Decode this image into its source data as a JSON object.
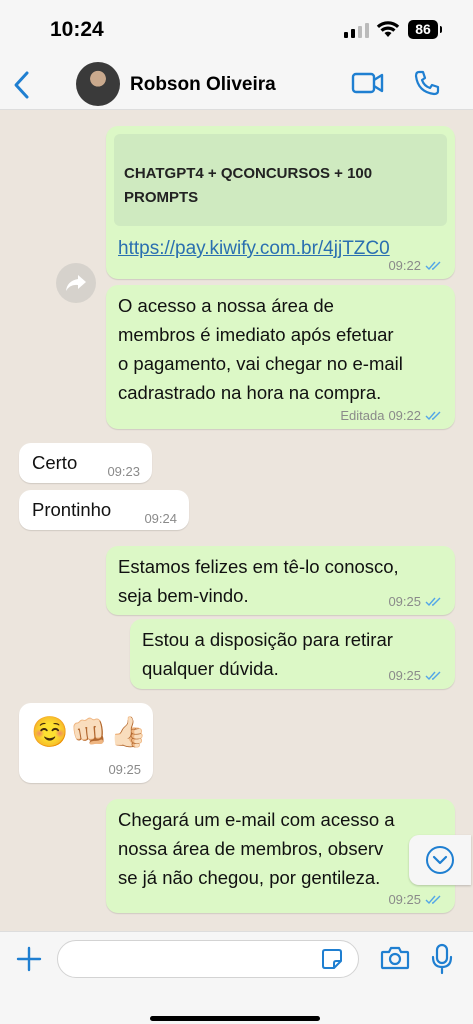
{
  "status_bar": {
    "time": "10:24",
    "battery": "86"
  },
  "header": {
    "contact_name": "Robson Oliveira"
  },
  "messages": [
    {
      "link_title": "CHATGPT4 + QCONCURSOS + 100 PROMPTS",
      "link_url": "https://pay.kiwify.com.br/4jjTZC0",
      "time": "09:22"
    },
    {
      "text_lines": [
        "O acesso a nossa área de",
        "membros é imediato após efetuar",
        "o pagamento, vai chegar no e-mail",
        "cadrastrado na hora na compra."
      ],
      "edited_label": "Editada",
      "time": "09:22"
    },
    {
      "text": "Certo",
      "time": "09:23"
    },
    {
      "text": "Prontinho",
      "time": "09:24"
    },
    {
      "text_lines": [
        "Estamos felizes em tê-lo conosco,",
        "seja bem-vindo."
      ],
      "time": "09:25"
    },
    {
      "text_lines": [
        "Estou a disposição para retirar",
        "qualquer dúvida."
      ],
      "time": "09:25"
    },
    {
      "emojis": "☺️👊🏻👍🏻",
      "time": "09:25"
    },
    {
      "text_lines": [
        "Chegará um e-mail com acesso a",
        "nossa área de membros, observ",
        "se já não chegou, por gentileza."
      ],
      "time": "09:25"
    }
  ],
  "input": {
    "placeholder": ""
  },
  "colors": {
    "outgoing_bubble": "#dcf8c6",
    "incoming_bubble": "#ffffff",
    "accent": "#1f7fd1",
    "link": "#2a6fb0",
    "read_ticks": "#53a6e8"
  },
  "icons": [
    "back-icon",
    "video-call-icon",
    "voice-call-icon",
    "forward-icon",
    "read-receipt-icon",
    "scroll-down-icon",
    "plus-icon",
    "sticker-icon",
    "camera-icon",
    "microphone-icon"
  ]
}
